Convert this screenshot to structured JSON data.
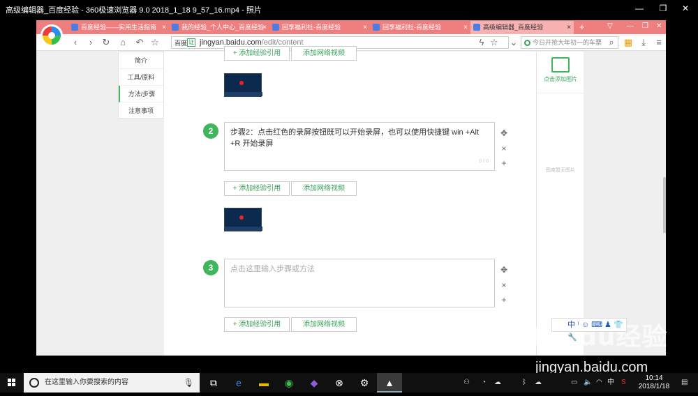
{
  "window": {
    "title": "高级编辑器_百度经验 - 360极速浏览器 9.0 2018_1_18 9_57_16.mp4 - 照片",
    "minimize": "—",
    "maximize": "❐",
    "close": "✕"
  },
  "browser": {
    "tabs": [
      {
        "label": "百度经验——实用生活指南",
        "close": "×"
      },
      {
        "label": "我的经验_个人中心_百度经验",
        "close": "×"
      },
      {
        "label": "回享福利社-百度经验",
        "close": "×"
      },
      {
        "label": "回享福利社-百度经验",
        "close": "×"
      },
      {
        "label": "高级编辑器_百度经验",
        "close": "×",
        "active": true
      }
    ],
    "new_tab": "+",
    "address": {
      "site_label": "百度",
      "cert_badge": "证",
      "domain": "jingyan.baidu.com",
      "path": "/edit/content"
    },
    "search_placeholder": "今日开抢大年初一的车票"
  },
  "sidebar": {
    "items": [
      {
        "label": "简介"
      },
      {
        "label": "工具/原料"
      },
      {
        "label": "方法/步骤",
        "active": true
      },
      {
        "label": "注意事项"
      }
    ]
  },
  "editor": {
    "add_ref_label": "+ 添加经验引用",
    "add_video_label": "添加网络视频",
    "steps": [
      {
        "number": "2",
        "text": "步骤2：点击红色的录屏按钮既可以开始录屏，也可以使用快捷键 win +Alt +R 开始录屏",
        "counter": "0 / 0"
      },
      {
        "number": "3",
        "placeholder": "点击这里输入步骤或方法"
      }
    ],
    "ctrl_move": "✥",
    "ctrl_delete": "×",
    "ctrl_add": "+"
  },
  "right_panel": {
    "add_image_label": "点击添加图片",
    "empty_label": "图库暂无图片"
  },
  "watermark": {
    "logo": "Baidu经验",
    "url": "jingyan.baidu.com"
  },
  "ime": {
    "label": "中 ⁾ ☺ ⌨ ♟ 👕 🔧"
  },
  "taskbar": {
    "search_placeholder": "在这里输入你要搜索的内容",
    "tray_lang": "中",
    "time": "10:14",
    "date": "2018/1/18"
  }
}
